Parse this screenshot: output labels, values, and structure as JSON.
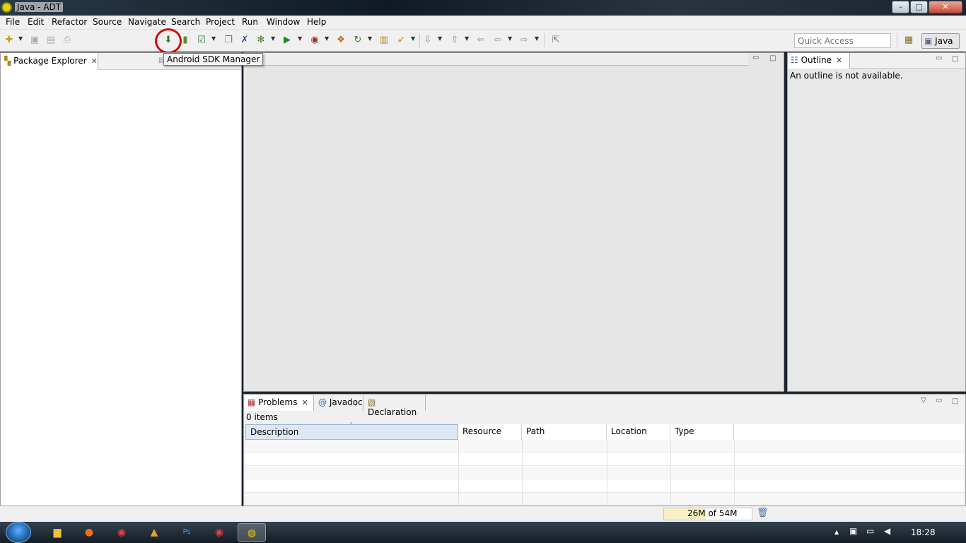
{
  "window": {
    "title": "Java - ADT",
    "min": "–",
    "max": "□",
    "close": "✕"
  },
  "menu": [
    "File",
    "Edit",
    "Refactor",
    "Source",
    "Navigate",
    "Search",
    "Project",
    "Run",
    "Window",
    "Help"
  ],
  "toolbar": {
    "tooltip": "Android SDK Manager",
    "quick_access_placeholder": "Quick Access",
    "perspective": "Java",
    "icons": {
      "new": "✚",
      "save": "▣",
      "save_all": "▤",
      "print": "⎙",
      "sdk": "⬇",
      "avd": "▮",
      "check": "☑",
      "new_project": "❐",
      "x": "✗",
      "debug": "✻",
      "run": "▶",
      "ext": "◉",
      "pkg": "❖",
      "refresh": "↻",
      "open": "▥",
      "search": "➶",
      "next": "⇩",
      "prev": "⇧",
      "back_edit": "⇐",
      "back": "⇦",
      "fwd": "⇨",
      "pin": "⇱",
      "open_persp": "▦"
    }
  },
  "package_explorer": {
    "title": "Package Explorer",
    "close": "✕",
    "min": "▭",
    "max": "□"
  },
  "outline": {
    "title": "Outline",
    "close": "✕",
    "message": "An outline is not available.",
    "min": "▭",
    "max": "□"
  },
  "bottom": {
    "tabs": {
      "problems": "Problems",
      "javadoc": "Javadoc",
      "declaration": "Declaration",
      "close": "✕"
    },
    "javadoc_symbol": "@",
    "count": "0 items",
    "sort_indicator": "ˆ",
    "columns": [
      "Description",
      "Resource",
      "Path",
      "Location",
      "Type"
    ],
    "view_menu": "▽",
    "min": "▭",
    "max": "□"
  },
  "status": {
    "heap": "26M of 54M",
    "heap_fraction": 0.48,
    "gc": "🗑"
  },
  "taskbar": {
    "clock": "18:28",
    "tray_up": "▲"
  },
  "colors": {
    "accent": "#cc1010",
    "selection": "#dde8f4"
  }
}
